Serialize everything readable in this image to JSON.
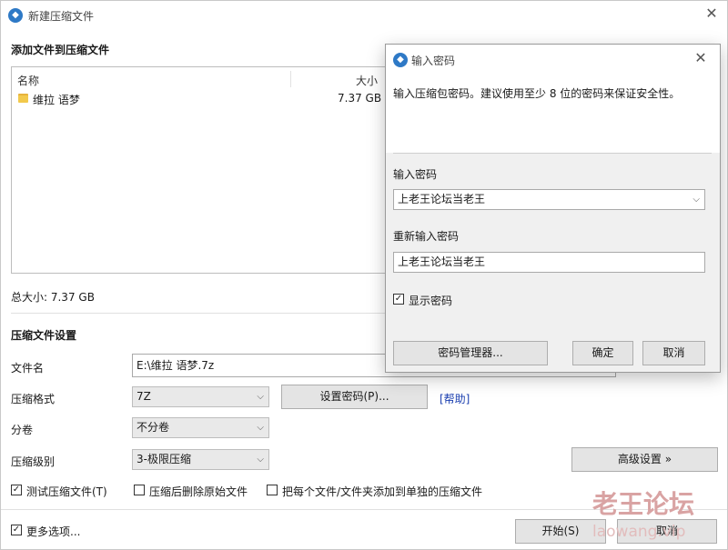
{
  "window": {
    "title": "新建压缩文件"
  },
  "add_section": {
    "title": "添加文件到压缩文件"
  },
  "file_list": {
    "columns": [
      "名称",
      "大小"
    ],
    "rows": [
      {
        "name": "维拉 语梦",
        "size": "7.37 GB"
      }
    ]
  },
  "total_size": "总大小: 7.37 GB",
  "settings": {
    "title": "压缩文件设置",
    "filename_label": "文件名",
    "filename_value": "E:\\维拉 语梦.7z",
    "format_label": "压缩格式",
    "format_value": "7Z",
    "set_password_button": "设置密码(P)...",
    "help_link": "[帮助]",
    "volume_label": "分卷",
    "volume_value": "不分卷",
    "level_label": "压缩级别",
    "level_value": "3-极限压缩",
    "advanced_button": "高级设置 »"
  },
  "options": {
    "test_archive": {
      "label": "测试压缩文件(T)",
      "checked": true
    },
    "delete_after": {
      "label": "压缩后删除原始文件",
      "checked": false
    },
    "separate_each": {
      "label": "把每个文件/文件夹添加到单独的压缩文件",
      "checked": false
    },
    "more_options": {
      "label": "更多选项...",
      "checked": true
    }
  },
  "footer": {
    "start_button": "开始(S)",
    "cancel_button": "取消"
  },
  "password_dialog": {
    "title": "输入密码",
    "hint": "输入压缩包密码。建议使用至少 8 位的密码来保证安全性。",
    "password_label": "输入密码",
    "password_value": "上老王论坛当老王",
    "reenter_label": "重新输入密码",
    "reenter_value": "上老王论坛当老王",
    "show_password": {
      "label": "显示密码",
      "checked": true
    },
    "manager_button": "密码管理器...",
    "ok_button": "确定",
    "cancel_button": "取消"
  },
  "watermark": {
    "line1": "老王论坛",
    "line2": "laowang.vip"
  }
}
